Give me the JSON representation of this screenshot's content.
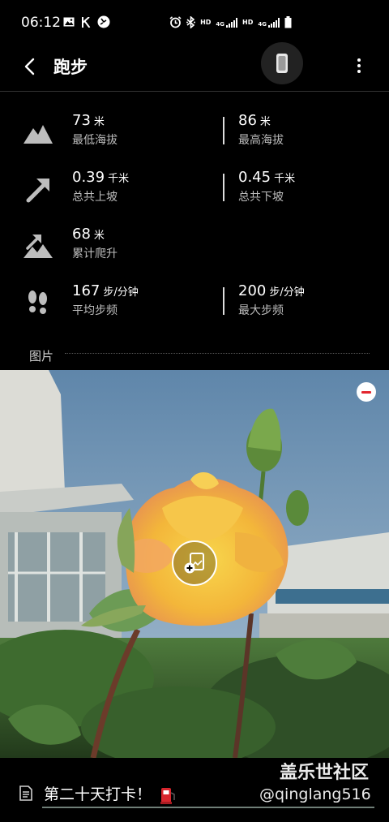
{
  "status_bar": {
    "time": "06:12",
    "left_icons": [
      "gallery-icon",
      "k-icon",
      "alarm-clock-app-icon"
    ],
    "right_icons": [
      "alarm-icon",
      "bluetooth-icon",
      "hd-icon",
      "lte-signal-icon",
      "hd-icon",
      "lte-signal-icon",
      "battery-icon"
    ],
    "hd_label": "HD",
    "net_label": "4G"
  },
  "header": {
    "title": "跑步"
  },
  "stats": {
    "row1": {
      "left": {
        "value": "73",
        "unit": "米",
        "label": "最低海拔"
      },
      "right": {
        "value": "86",
        "unit": "米",
        "label": "最高海拔"
      }
    },
    "row2": {
      "left": {
        "value": "0.39",
        "unit": "千米",
        "label": "总共上坡"
      },
      "right": {
        "value": "0.45",
        "unit": "千米",
        "label": "总共下坡"
      }
    },
    "row3": {
      "left": {
        "value": "68",
        "unit": "米",
        "label": "累计爬升"
      }
    },
    "row4": {
      "left": {
        "value": "167",
        "unit": "步/分钟",
        "label": "平均步频"
      },
      "right": {
        "value": "200",
        "unit": "步/分钟",
        "label": "最大步频"
      }
    }
  },
  "pictures_section": {
    "title": "图片"
  },
  "memo": {
    "text": "第二十天打卡！"
  },
  "watermark": {
    "line1": "盖乐世社区",
    "line2": "@qinglang516"
  },
  "colors": {
    "background": "#000000",
    "remove_red": "#e3262f",
    "underline": "#6f7e77"
  }
}
